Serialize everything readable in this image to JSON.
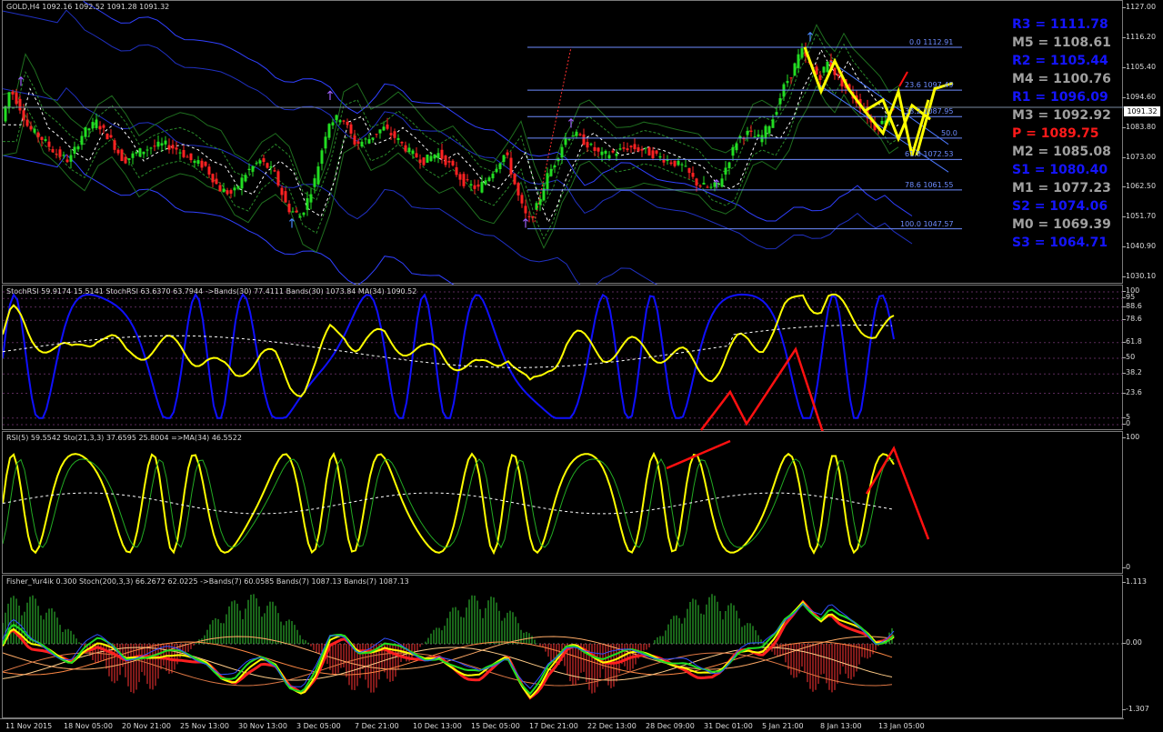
{
  "chart": {
    "symbol_line": "GOLD,H4  1092.16 1092.52 1091.28 1091.32",
    "current_price": "1091.32",
    "price_axis": [
      "1127.00",
      "1116.20",
      "1105.40",
      "1094.60",
      "1083.80",
      "1073.00",
      "1062.50",
      "1051.70",
      "1040.90",
      "1030.10"
    ],
    "x_axis": [
      "11 Nov 2015",
      "18 Nov 05:00",
      "20 Nov 21:00",
      "25 Nov 13:00",
      "30 Nov 13:00",
      "3 Dec 05:00",
      "7 Dec 21:00",
      "10 Dec 13:00",
      "15 Dec 05:00",
      "17 Dec 21:00",
      "22 Dec 13:00",
      "28 Dec 09:00",
      "31 Dec 01:00",
      "5 Jan 21:00",
      "8 Jan 13:00",
      "13 Jan 05:00"
    ],
    "fibo_levels": [
      {
        "label": "0.0 1112.91",
        "value": 1112.91
      },
      {
        "label": "23.6 1097.49",
        "value": 1097.49
      },
      {
        "label": "38.2 1087.95",
        "value": 1087.95
      },
      {
        "label": "50.0",
        "value": 1080.24
      },
      {
        "label": "61.8 1072.53",
        "value": 1072.53
      },
      {
        "label": "78.6 1061.55",
        "value": 1061.55
      },
      {
        "label": "100.0 1047.57",
        "value": 1047.57
      }
    ],
    "pivots": [
      {
        "label": "R3 = 1111.78",
        "color": "#1515ff"
      },
      {
        "label": "M5 = 1108.61",
        "color": "#a0a0a0"
      },
      {
        "label": "R2 = 1105.44",
        "color": "#1515ff"
      },
      {
        "label": "M4 = 1100.76",
        "color": "#a0a0a0"
      },
      {
        "label": "R1 = 1096.09",
        "color": "#1515ff"
      },
      {
        "label": "M3 = 1092.92",
        "color": "#a0a0a0"
      },
      {
        "label": "P  = 1089.75",
        "color": "#ff1a1a"
      },
      {
        "label": "M2 = 1085.08",
        "color": "#a0a0a0"
      },
      {
        "label": "S1 = 1080.40",
        "color": "#1515ff"
      },
      {
        "label": "M1 = 1077.23",
        "color": "#a0a0a0"
      },
      {
        "label": "S2 = 1074.06",
        "color": "#1515ff"
      },
      {
        "label": "M0 = 1069.39",
        "color": "#a0a0a0"
      },
      {
        "label": "S3 = 1064.71",
        "color": "#1515ff"
      }
    ]
  },
  "stochrsi": {
    "title": "StochRSI 59.9174 15.5141  StochRSI 63.6370 63.7944  ->Bands(30) 77.4111  Bands(30) 1073.84  MA(34) 1090.52",
    "axis": [
      "100",
      "95",
      "88.6",
      "78.6",
      "61.8",
      "50",
      "38.2",
      "23.6",
      "5",
      "0"
    ]
  },
  "rsi": {
    "title": "RSI(5) 59.5542  Sto(21,3,3) 37.6595 25.8004  =>MA(34) 46.5522",
    "axis": [
      "100",
      "0"
    ]
  },
  "fisher": {
    "title": "Fisher_Yur4ik 0.300  Stoch(200,3,3) 66.2672 62.0225  ->Bands(7) 60.0585  Bands(7) 1087.13  Bands(7) 1087.13",
    "axis": [
      "1.113",
      "0.00",
      "-1.307"
    ]
  },
  "colors": {
    "bull": "#22dd22",
    "bear": "#ff2222",
    "yellow": "#ffff00",
    "blue": "#1010ff",
    "fibo": "#6e8cff",
    "red_arrow": "#ff1010"
  },
  "chart_data": {
    "type": "candlestick",
    "symbol": "GOLD",
    "timeframe": "H4",
    "ohlc_last": {
      "open": 1092.16,
      "high": 1092.52,
      "low": 1091.28,
      "close": 1091.32
    },
    "ylim": [
      1030.1,
      1127.0
    ],
    "price_path": [
      [
        0,
        1085
      ],
      [
        10,
        1098
      ],
      [
        20,
        1092
      ],
      [
        30,
        1084
      ],
      [
        45,
        1080
      ],
      [
        60,
        1075
      ],
      [
        75,
        1072
      ],
      [
        90,
        1082
      ],
      [
        105,
        1086
      ],
      [
        120,
        1080
      ],
      [
        135,
        1072
      ],
      [
        150,
        1075
      ],
      [
        165,
        1077
      ],
      [
        180,
        1078
      ],
      [
        195,
        1076
      ],
      [
        210,
        1072
      ],
      [
        225,
        1070
      ],
      [
        240,
        1062
      ],
      [
        255,
        1060
      ],
      [
        270,
        1068
      ],
      [
        285,
        1072
      ],
      [
        300,
        1068
      ],
      [
        315,
        1055
      ],
      [
        330,
        1052
      ],
      [
        345,
        1065
      ],
      [
        360,
        1086
      ],
      [
        375,
        1088
      ],
      [
        390,
        1078
      ],
      [
        405,
        1080
      ],
      [
        420,
        1084
      ],
      [
        435,
        1080
      ],
      [
        450,
        1075
      ],
      [
        465,
        1072
      ],
      [
        480,
        1075
      ],
      [
        495,
        1070
      ],
      [
        510,
        1064
      ],
      [
        525,
        1062
      ],
      [
        540,
        1068
      ],
      [
        555,
        1075
      ],
      [
        570,
        1058
      ],
      [
        580,
        1050
      ],
      [
        590,
        1056
      ],
      [
        600,
        1066
      ],
      [
        610,
        1072
      ],
      [
        620,
        1080
      ],
      [
        630,
        1082
      ],
      [
        645,
        1078
      ],
      [
        660,
        1074
      ],
      [
        675,
        1075
      ],
      [
        690,
        1077
      ],
      [
        705,
        1076
      ],
      [
        720,
        1074
      ],
      [
        735,
        1072
      ],
      [
        750,
        1070
      ],
      [
        765,
        1064
      ],
      [
        780,
        1062
      ],
      [
        790,
        1064
      ],
      [
        800,
        1072
      ],
      [
        810,
        1080
      ],
      [
        820,
        1082
      ],
      [
        835,
        1080
      ],
      [
        850,
        1088
      ],
      [
        860,
        1098
      ],
      [
        870,
        1104
      ],
      [
        880,
        1112
      ],
      [
        890,
        1106
      ],
      [
        900,
        1102
      ],
      [
        910,
        1108
      ],
      [
        920,
        1102
      ],
      [
        930,
        1098
      ],
      [
        940,
        1094
      ],
      [
        950,
        1090
      ],
      [
        960,
        1084
      ],
      [
        970,
        1086
      ],
      [
        980,
        1091
      ]
    ]
  }
}
